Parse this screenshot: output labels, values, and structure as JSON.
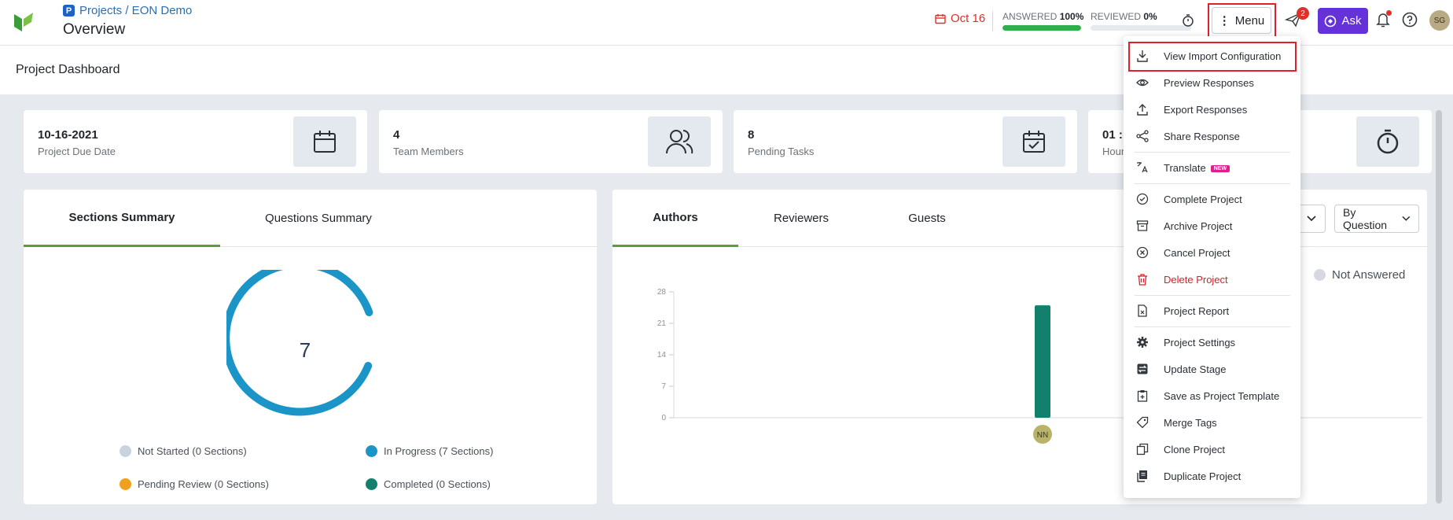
{
  "header": {
    "breadcrumb": "Projects / EON Demo",
    "page_title": "Overview",
    "due_date": "Oct 16",
    "answered_label": "ANSWERED",
    "answered_value": "100%",
    "answered_fraction": 1.0,
    "reviewed_label": "REVIEWED",
    "reviewed_value": "0%",
    "reviewed_fraction": 0.0,
    "menu_label": "Menu",
    "notifications_count": "2",
    "ask_label": "Ask",
    "avatar_initials": "SG"
  },
  "subheader": {
    "title": "Project Dashboard"
  },
  "cards": [
    {
      "value": "10-16-2021",
      "label": "Project Due Date",
      "icon": "calendar-icon"
    },
    {
      "value": "4",
      "label": "Team Members",
      "icon": "users-icon"
    },
    {
      "value": "8",
      "label": "Pending Tasks",
      "icon": "calendar-check-icon"
    },
    {
      "value": "01 :",
      "label": "Hour",
      "icon": "stopwatch-icon"
    }
  ],
  "sections_panel": {
    "tabs": [
      "Sections Summary",
      "Questions Summary"
    ],
    "active_tab": "Sections Summary",
    "donut_center": "7",
    "legend": [
      {
        "label": "Not Started (0 Sections)",
        "color": "#c9d3e0"
      },
      {
        "label": "In Progress (7 Sections)",
        "color": "#1b95c8"
      },
      {
        "label": "Pending Review (0 Sections)",
        "color": "#f0a01c"
      },
      {
        "label": "Completed (0 Sections)",
        "color": "#13806e"
      }
    ]
  },
  "authors_panel": {
    "tabs": [
      "Authors",
      "Reviewers",
      "Guests"
    ],
    "active_tab": "Authors",
    "filter_label": "By Question",
    "legend_not_answered": "Not Answered",
    "chart_data": {
      "type": "bar",
      "categories": [
        "NN"
      ],
      "values": [
        25
      ],
      "ylim": [
        0,
        28
      ],
      "yticks": [
        "0",
        "7",
        "14",
        "21",
        "28"
      ],
      "bar_color": "#13806e"
    }
  },
  "menu": {
    "items": [
      {
        "label": "View Import Configuration",
        "icon": "download-icon",
        "highlighted": true
      },
      {
        "label": "Preview Responses",
        "icon": "eye-icon"
      },
      {
        "label": "Export Responses",
        "icon": "upload-icon"
      },
      {
        "label": "Share Response",
        "icon": "share-icon"
      },
      {
        "label": "Translate",
        "icon": "translate-icon",
        "badge": "NEW"
      },
      {
        "label": "Complete Project",
        "icon": "check-circle-icon"
      },
      {
        "label": "Archive Project",
        "icon": "archive-icon"
      },
      {
        "label": "Cancel Project",
        "icon": "x-circle-icon"
      },
      {
        "label": "Delete Project",
        "icon": "trash-icon",
        "danger": true
      },
      {
        "label": "Project Report",
        "icon": "report-icon"
      },
      {
        "label": "Project Settings",
        "icon": "gear-icon"
      },
      {
        "label": "Update Stage",
        "icon": "stage-icon"
      },
      {
        "label": "Save as Project Template",
        "icon": "template-icon"
      },
      {
        "label": "Merge Tags",
        "icon": "tag-icon"
      },
      {
        "label": "Clone Project",
        "icon": "copy-icon"
      },
      {
        "label": "Duplicate Project",
        "icon": "duplicate-icon"
      }
    ]
  }
}
